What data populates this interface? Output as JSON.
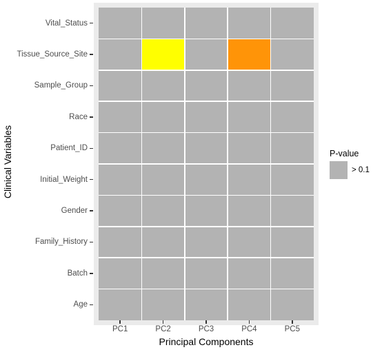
{
  "chart_data": {
    "type": "heatmap",
    "title": "",
    "xlabel": "Principal Components",
    "ylabel": "Clinical Variables",
    "x_categories": [
      "PC1",
      "PC2",
      "PC3",
      "PC4",
      "PC5"
    ],
    "y_categories": [
      "Vital_Status",
      "Tissue_Source_Site",
      "Sample_Group",
      "Race",
      "Patient_ID",
      "Initial_Weight",
      "Gender",
      "Family_History",
      "Batch",
      "Age"
    ],
    "cells": [
      {
        "row": "Vital_Status",
        "col": "PC1",
        "color": "#b3b3b3",
        "pvalue_class": "> 0.1"
      },
      {
        "row": "Vital_Status",
        "col": "PC2",
        "color": "#b3b3b3",
        "pvalue_class": "> 0.1"
      },
      {
        "row": "Vital_Status",
        "col": "PC3",
        "color": "#b3b3b3",
        "pvalue_class": "> 0.1"
      },
      {
        "row": "Vital_Status",
        "col": "PC4",
        "color": "#b3b3b3",
        "pvalue_class": "> 0.1"
      },
      {
        "row": "Vital_Status",
        "col": "PC5",
        "color": "#b3b3b3",
        "pvalue_class": "> 0.1"
      },
      {
        "row": "Tissue_Source_Site",
        "col": "PC1",
        "color": "#b3b3b3",
        "pvalue_class": "> 0.1"
      },
      {
        "row": "Tissue_Source_Site",
        "col": "PC2",
        "color": "#ffff00",
        "pvalue_class": "significant"
      },
      {
        "row": "Tissue_Source_Site",
        "col": "PC3",
        "color": "#b3b3b3",
        "pvalue_class": "> 0.1"
      },
      {
        "row": "Tissue_Source_Site",
        "col": "PC4",
        "color": "#ff9408",
        "pvalue_class": "significant"
      },
      {
        "row": "Tissue_Source_Site",
        "col": "PC5",
        "color": "#b3b3b3",
        "pvalue_class": "> 0.1"
      },
      {
        "row": "Sample_Group",
        "col": "PC1",
        "color": "#b3b3b3",
        "pvalue_class": "> 0.1"
      },
      {
        "row": "Sample_Group",
        "col": "PC2",
        "color": "#b3b3b3",
        "pvalue_class": "> 0.1"
      },
      {
        "row": "Sample_Group",
        "col": "PC3",
        "color": "#b3b3b3",
        "pvalue_class": "> 0.1"
      },
      {
        "row": "Sample_Group",
        "col": "PC4",
        "color": "#b3b3b3",
        "pvalue_class": "> 0.1"
      },
      {
        "row": "Sample_Group",
        "col": "PC5",
        "color": "#b3b3b3",
        "pvalue_class": "> 0.1"
      },
      {
        "row": "Race",
        "col": "PC1",
        "color": "#b3b3b3",
        "pvalue_class": "> 0.1"
      },
      {
        "row": "Race",
        "col": "PC2",
        "color": "#b3b3b3",
        "pvalue_class": "> 0.1"
      },
      {
        "row": "Race",
        "col": "PC3",
        "color": "#b3b3b3",
        "pvalue_class": "> 0.1"
      },
      {
        "row": "Race",
        "col": "PC4",
        "color": "#b3b3b3",
        "pvalue_class": "> 0.1"
      },
      {
        "row": "Race",
        "col": "PC5",
        "color": "#b3b3b3",
        "pvalue_class": "> 0.1"
      },
      {
        "row": "Patient_ID",
        "col": "PC1",
        "color": "#b3b3b3",
        "pvalue_class": "> 0.1"
      },
      {
        "row": "Patient_ID",
        "col": "PC2",
        "color": "#b3b3b3",
        "pvalue_class": "> 0.1"
      },
      {
        "row": "Patient_ID",
        "col": "PC3",
        "color": "#b3b3b3",
        "pvalue_class": "> 0.1"
      },
      {
        "row": "Patient_ID",
        "col": "PC4",
        "color": "#b3b3b3",
        "pvalue_class": "> 0.1"
      },
      {
        "row": "Patient_ID",
        "col": "PC5",
        "color": "#b3b3b3",
        "pvalue_class": "> 0.1"
      },
      {
        "row": "Initial_Weight",
        "col": "PC1",
        "color": "#b3b3b3",
        "pvalue_class": "> 0.1"
      },
      {
        "row": "Initial_Weight",
        "col": "PC2",
        "color": "#b3b3b3",
        "pvalue_class": "> 0.1"
      },
      {
        "row": "Initial_Weight",
        "col": "PC3",
        "color": "#b3b3b3",
        "pvalue_class": "> 0.1"
      },
      {
        "row": "Initial_Weight",
        "col": "PC4",
        "color": "#b3b3b3",
        "pvalue_class": "> 0.1"
      },
      {
        "row": "Initial_Weight",
        "col": "PC5",
        "color": "#b3b3b3",
        "pvalue_class": "> 0.1"
      },
      {
        "row": "Gender",
        "col": "PC1",
        "color": "#b3b3b3",
        "pvalue_class": "> 0.1"
      },
      {
        "row": "Gender",
        "col": "PC2",
        "color": "#b3b3b3",
        "pvalue_class": "> 0.1"
      },
      {
        "row": "Gender",
        "col": "PC3",
        "color": "#b3b3b3",
        "pvalue_class": "> 0.1"
      },
      {
        "row": "Gender",
        "col": "PC4",
        "color": "#b3b3b3",
        "pvalue_class": "> 0.1"
      },
      {
        "row": "Gender",
        "col": "PC5",
        "color": "#b3b3b3",
        "pvalue_class": "> 0.1"
      },
      {
        "row": "Family_History",
        "col": "PC1",
        "color": "#b3b3b3",
        "pvalue_class": "> 0.1"
      },
      {
        "row": "Family_History",
        "col": "PC2",
        "color": "#b3b3b3",
        "pvalue_class": "> 0.1"
      },
      {
        "row": "Family_History",
        "col": "PC3",
        "color": "#b3b3b3",
        "pvalue_class": "> 0.1"
      },
      {
        "row": "Family_History",
        "col": "PC4",
        "color": "#b3b3b3",
        "pvalue_class": "> 0.1"
      },
      {
        "row": "Family_History",
        "col": "PC5",
        "color": "#b3b3b3",
        "pvalue_class": "> 0.1"
      },
      {
        "row": "Batch",
        "col": "PC1",
        "color": "#b3b3b3",
        "pvalue_class": "> 0.1"
      },
      {
        "row": "Batch",
        "col": "PC2",
        "color": "#b3b3b3",
        "pvalue_class": "> 0.1"
      },
      {
        "row": "Batch",
        "col": "PC3",
        "color": "#b3b3b3",
        "pvalue_class": "> 0.1"
      },
      {
        "row": "Batch",
        "col": "PC4",
        "color": "#b3b3b3",
        "pvalue_class": "> 0.1"
      },
      {
        "row": "Batch",
        "col": "PC5",
        "color": "#b3b3b3",
        "pvalue_class": "> 0.1"
      },
      {
        "row": "Age",
        "col": "PC1",
        "color": "#b3b3b3",
        "pvalue_class": "> 0.1"
      },
      {
        "row": "Age",
        "col": "PC2",
        "color": "#b3b3b3",
        "pvalue_class": "> 0.1"
      },
      {
        "row": "Age",
        "col": "PC3",
        "color": "#b3b3b3",
        "pvalue_class": "> 0.1"
      },
      {
        "row": "Age",
        "col": "PC4",
        "color": "#b3b3b3",
        "pvalue_class": "> 0.1"
      },
      {
        "row": "Age",
        "col": "PC5",
        "color": "#b3b3b3",
        "pvalue_class": "> 0.1"
      }
    ],
    "legend": {
      "title": "P-value",
      "position": "right",
      "entries": [
        {
          "label": "> 0.1",
          "color": "#b3b3b3"
        }
      ]
    },
    "grid": true,
    "panel_background": "#b3b3b3",
    "grid_color": "#ffffff"
  }
}
